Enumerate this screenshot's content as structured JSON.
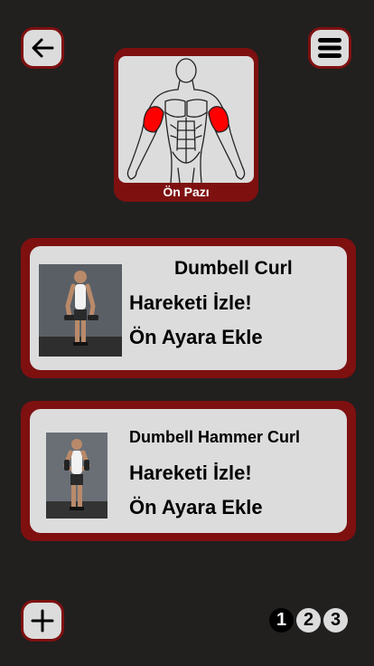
{
  "muscle": {
    "label": "Ön Pazı"
  },
  "exercises": [
    {
      "title": "Dumbell Curl",
      "watch_label": "Hareketi İzle!",
      "preset_label": "Ön Ayara Ekle"
    },
    {
      "title": "Dumbell Hammer Curl",
      "watch_label": "Hareketi İzle!",
      "preset_label": "Ön Ayara Ekle"
    }
  ],
  "pagination": {
    "pages": [
      "1",
      "2",
      "3"
    ],
    "current": "1"
  },
  "colors": {
    "background": "#221f1f",
    "accent": "#7e1010",
    "card": "#dcdcdc",
    "highlight": "#ff0000"
  },
  "icons": {
    "back": "arrow-left-icon",
    "menu": "hamburger-menu-icon",
    "add": "plus-icon"
  }
}
